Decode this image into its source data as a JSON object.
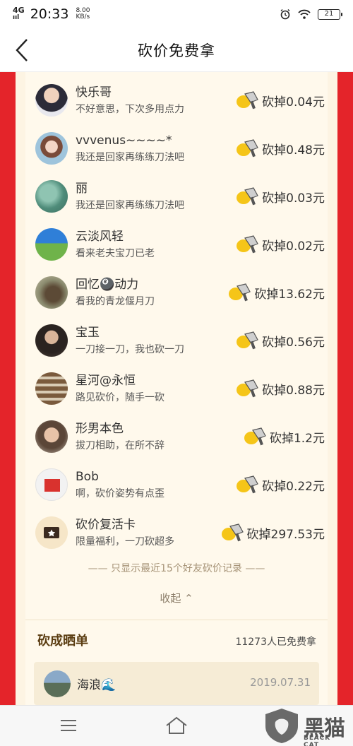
{
  "status": {
    "network": "4G",
    "signal": "ııl",
    "time": "20:33",
    "speed_value": "8.00",
    "speed_unit": "KB/s",
    "battery": "21"
  },
  "nav": {
    "title": "砍价免费拿",
    "back_icon": "chevron-left-icon"
  },
  "bargain_records": [
    {
      "name": "快乐哥",
      "comment": "不好意思，下次多用点力",
      "amount": "砍掉0.04元"
    },
    {
      "name": "vvvenus~~~~*",
      "comment": "我还是回家再练练刀法吧",
      "amount": "砍掉0.48元"
    },
    {
      "name": "丽",
      "comment": "我还是回家再练练刀法吧",
      "amount": "砍掉0.03元"
    },
    {
      "name": "云淡风轻",
      "comment": "看来老夫宝刀已老",
      "amount": "砍掉0.02元"
    },
    {
      "name": "回忆🎱动力",
      "comment": "看我的青龙偃月刀",
      "amount": "砍掉13.62元"
    },
    {
      "name": "宝玉",
      "comment": "一刀接一刀，我也砍一刀",
      "amount": "砍掉0.56元"
    },
    {
      "name": "星河@永恒",
      "comment": "路见砍价，随手一砍",
      "amount": "砍掉0.88元"
    },
    {
      "name": "形男本色",
      "comment": "拔刀相助，在所不辞",
      "amount": "砍掉1.2元"
    },
    {
      "name": "Bob",
      "comment": "啊，砍价姿势有点歪",
      "amount": "砍掉0.22元"
    },
    {
      "name": "砍价复活卡",
      "comment": "限量福利，一刀砍超多",
      "amount": "砍掉297.53元"
    }
  ],
  "hint_text": "—— 只显示最近15个好友砍价记录 ——",
  "collapse_label": "收起 ⌃",
  "section": {
    "title": "砍成晒单",
    "count": "11273人已免费拿"
  },
  "share": {
    "user": "海浪🌊",
    "date": "2019.07.31"
  },
  "watermark": {
    "text": "黑猫",
    "sub": "BLACK CAT"
  },
  "colors": {
    "frame_red": "#e4242a",
    "panel_bg": "#fdf4e3",
    "knife_yellow": "#f5c518"
  }
}
